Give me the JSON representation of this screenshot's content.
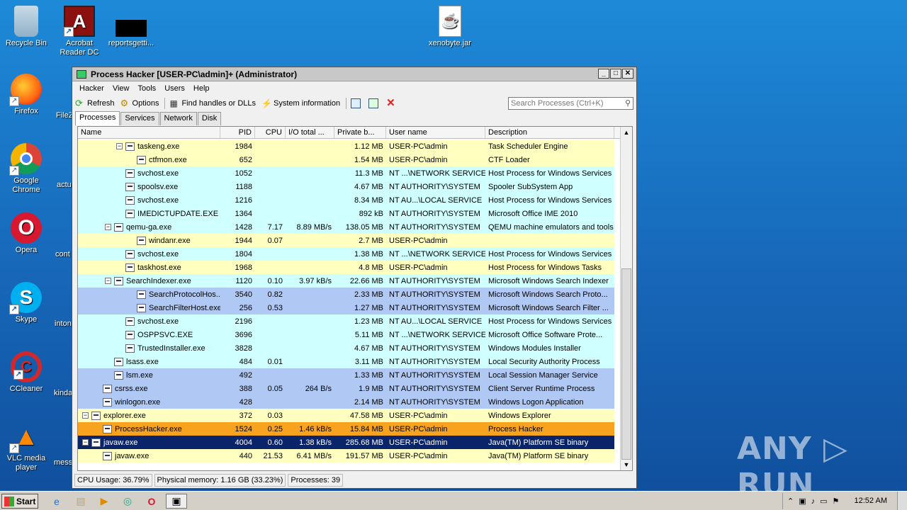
{
  "desktop": {
    "icons": [
      {
        "label": "Recycle Bin",
        "glyph": "🗑"
      },
      {
        "label": "Acrobat Reader DC",
        "glyph": "A"
      },
      {
        "label": "reportsgetti...",
        "glyph": ""
      },
      {
        "label": "xenobyte.jar",
        "glyph": "☕"
      },
      {
        "label": "Firefox",
        "glyph": "🦊"
      },
      {
        "label": "Google Chrome",
        "glyph": "◎"
      },
      {
        "label": "Opera",
        "glyph": "O"
      },
      {
        "label": "Skype",
        "glyph": "S"
      },
      {
        "label": "CCleaner",
        "glyph": "C"
      },
      {
        "label": "VLC media player",
        "glyph": "▲"
      }
    ],
    "cut_labels": [
      "FileZ",
      "actu",
      "cont",
      "inton",
      "kinda",
      "mess"
    ],
    "watermark": "ANY ▷ RUN"
  },
  "window": {
    "title": "Process Hacker [USER-PC\\admin]+ (Administrator)",
    "menu": [
      "Hacker",
      "View",
      "Tools",
      "Users",
      "Help"
    ],
    "toolbar": {
      "refresh": "Refresh",
      "options": "Options",
      "find_handles": "Find handles or DLLs",
      "system_info": "System information"
    },
    "search_placeholder": "Search Processes (Ctrl+K)",
    "tabs": [
      "Processes",
      "Services",
      "Network",
      "Disk"
    ],
    "columns": [
      "Name",
      "PID",
      "CPU",
      "I/O total ...",
      "Private b...",
      "User name",
      "Description"
    ],
    "rows": [
      {
        "indent": 3,
        "toggle": "−",
        "name": "taskeng.exe",
        "pid": "1984",
        "cpu": "",
        "io": "",
        "mem": "1.12 MB",
        "user": "USER-PC\\admin",
        "desc": "Task Scheduler Engine",
        "bg": "#ffffc0",
        "fg": "#000"
      },
      {
        "indent": 4,
        "toggle": "",
        "name": "ctfmon.exe",
        "pid": "652",
        "cpu": "",
        "io": "",
        "mem": "1.54 MB",
        "user": "USER-PC\\admin",
        "desc": "CTF Loader",
        "bg": "#ffffc0",
        "fg": "#000"
      },
      {
        "indent": 3,
        "toggle": "",
        "name": "svchost.exe",
        "pid": "1052",
        "cpu": "",
        "io": "",
        "mem": "11.3 MB",
        "user": "NT ...\\NETWORK SERVICE",
        "desc": "Host Process for Windows Services",
        "bg": "#d0ffff",
        "fg": "#000"
      },
      {
        "indent": 3,
        "toggle": "",
        "name": "spoolsv.exe",
        "pid": "1188",
        "cpu": "",
        "io": "",
        "mem": "4.67 MB",
        "user": "NT AUTHORITY\\SYSTEM",
        "desc": "Spooler SubSystem App",
        "bg": "#d0ffff",
        "fg": "#000"
      },
      {
        "indent": 3,
        "toggle": "",
        "name": "svchost.exe",
        "pid": "1216",
        "cpu": "",
        "io": "",
        "mem": "8.34 MB",
        "user": "NT AU...\\LOCAL SERVICE",
        "desc": "Host Process for Windows Services",
        "bg": "#d0ffff",
        "fg": "#000"
      },
      {
        "indent": 3,
        "toggle": "",
        "name": "IMEDICTUPDATE.EXE",
        "pid": "1364",
        "cpu": "",
        "io": "",
        "mem": "892 kB",
        "user": "NT AUTHORITY\\SYSTEM",
        "desc": "Microsoft Office IME 2010",
        "bg": "#d0ffff",
        "fg": "#000"
      },
      {
        "indent": 2,
        "toggle": "−",
        "name": "qemu-ga.exe",
        "pid": "1428",
        "cpu": "7.17",
        "io": "8.89 MB/s",
        "mem": "138.05 MB",
        "user": "NT AUTHORITY\\SYSTEM",
        "desc": "QEMU machine emulators and tools",
        "bg": "#d0ffff",
        "fg": "#000"
      },
      {
        "indent": 4,
        "toggle": "",
        "name": "windanr.exe",
        "pid": "1944",
        "cpu": "0.07",
        "io": "",
        "mem": "2.7 MB",
        "user": "USER-PC\\admin",
        "desc": "",
        "bg": "#ffffc0",
        "fg": "#000"
      },
      {
        "indent": 3,
        "toggle": "",
        "name": "svchost.exe",
        "pid": "1804",
        "cpu": "",
        "io": "",
        "mem": "1.38 MB",
        "user": "NT ...\\NETWORK SERVICE",
        "desc": "Host Process for Windows Services",
        "bg": "#d0ffff",
        "fg": "#000"
      },
      {
        "indent": 3,
        "toggle": "",
        "name": "taskhost.exe",
        "pid": "1968",
        "cpu": "",
        "io": "",
        "mem": "4.8 MB",
        "user": "USER-PC\\admin",
        "desc": "Host Process for Windows Tasks",
        "bg": "#ffffc0",
        "fg": "#000"
      },
      {
        "indent": 2,
        "toggle": "−",
        "name": "SearchIndexer.exe",
        "pid": "1120",
        "cpu": "0.10",
        "io": "3.97 kB/s",
        "mem": "22.66 MB",
        "user": "NT AUTHORITY\\SYSTEM",
        "desc": "Microsoft Windows Search Indexer",
        "bg": "#d0ffff",
        "fg": "#000"
      },
      {
        "indent": 4,
        "toggle": "",
        "name": "SearchProtocolHos...",
        "pid": "3540",
        "cpu": "0.82",
        "io": "",
        "mem": "2.33 MB",
        "user": "NT AUTHORITY\\SYSTEM",
        "desc": "Microsoft Windows Search Proto...",
        "bg": "#b0c8f4",
        "fg": "#000"
      },
      {
        "indent": 4,
        "toggle": "",
        "name": "SearchFilterHost.exe",
        "pid": "256",
        "cpu": "0.53",
        "io": "",
        "mem": "1.27 MB",
        "user": "NT AUTHORITY\\SYSTEM",
        "desc": "Microsoft Windows Search Filter ...",
        "bg": "#b0c8f4",
        "fg": "#000"
      },
      {
        "indent": 3,
        "toggle": "",
        "name": "svchost.exe",
        "pid": "2196",
        "cpu": "",
        "io": "",
        "mem": "1.23 MB",
        "user": "NT AU...\\LOCAL SERVICE",
        "desc": "Host Process for Windows Services",
        "bg": "#d0ffff",
        "fg": "#000"
      },
      {
        "indent": 3,
        "toggle": "",
        "name": "OSPPSVC.EXE",
        "pid": "3696",
        "cpu": "",
        "io": "",
        "mem": "5.11 MB",
        "user": "NT ...\\NETWORK SERVICE",
        "desc": "Microsoft Office Software Prote...",
        "bg": "#d0ffff",
        "fg": "#000"
      },
      {
        "indent": 3,
        "toggle": "",
        "name": "TrustedInstaller.exe",
        "pid": "3828",
        "cpu": "",
        "io": "",
        "mem": "4.67 MB",
        "user": "NT AUTHORITY\\SYSTEM",
        "desc": "Windows Modules Installer",
        "bg": "#d0ffff",
        "fg": "#000"
      },
      {
        "indent": 2,
        "toggle": "",
        "name": "lsass.exe",
        "pid": "484",
        "cpu": "0.01",
        "io": "",
        "mem": "3.11 MB",
        "user": "NT AUTHORITY\\SYSTEM",
        "desc": "Local Security Authority Process",
        "bg": "#d0ffff",
        "fg": "#000"
      },
      {
        "indent": 2,
        "toggle": "",
        "name": "lsm.exe",
        "pid": "492",
        "cpu": "",
        "io": "",
        "mem": "1.33 MB",
        "user": "NT AUTHORITY\\SYSTEM",
        "desc": "Local Session Manager Service",
        "bg": "#b0c8f4",
        "fg": "#000"
      },
      {
        "indent": 1,
        "toggle": "",
        "name": "csrss.exe",
        "pid": "388",
        "cpu": "0.05",
        "io": "264 B/s",
        "mem": "1.9 MB",
        "user": "NT AUTHORITY\\SYSTEM",
        "desc": "Client Server Runtime Process",
        "bg": "#b0c8f4",
        "fg": "#000"
      },
      {
        "indent": 1,
        "toggle": "",
        "name": "winlogon.exe",
        "pid": "428",
        "cpu": "",
        "io": "",
        "mem": "2.14 MB",
        "user": "NT AUTHORITY\\SYSTEM",
        "desc": "Windows Logon Application",
        "bg": "#b0c8f4",
        "fg": "#000"
      },
      {
        "indent": 0,
        "toggle": "−",
        "name": "explorer.exe",
        "pid": "372",
        "cpu": "0.03",
        "io": "",
        "mem": "47.58 MB",
        "user": "USER-PC\\admin",
        "desc": "Windows Explorer",
        "bg": "#ffffc0",
        "fg": "#000"
      },
      {
        "indent": 1,
        "toggle": "",
        "name": "ProcessHacker.exe",
        "pid": "1524",
        "cpu": "0.25",
        "io": "1.46 kB/s",
        "mem": "15.84 MB",
        "user": "USER-PC\\admin",
        "desc": "Process Hacker",
        "bg": "#f7a320",
        "fg": "#000"
      },
      {
        "indent": 0,
        "toggle": "−",
        "name": "javaw.exe",
        "pid": "4004",
        "cpu": "0.60",
        "io": "1.38 kB/s",
        "mem": "285.68 MB",
        "user": "USER-PC\\admin",
        "desc": "Java(TM) Platform SE binary",
        "bg": "#0a246a",
        "fg": "#fff"
      },
      {
        "indent": 1,
        "toggle": "",
        "name": "javaw.exe",
        "pid": "440",
        "cpu": "21.53",
        "io": "6.41 MB/s",
        "mem": "191.57 MB",
        "user": "USER-PC\\admin",
        "desc": "Java(TM) Platform SE binary",
        "bg": "#ffffc0",
        "fg": "#000"
      }
    ],
    "status": {
      "cpu": "CPU Usage: 36.79%",
      "memory": "Physical memory: 1.16 GB (33.23%)",
      "processes": "Processes: 39"
    }
  },
  "taskbar": {
    "start": "Start",
    "clock": "12:52 AM"
  }
}
